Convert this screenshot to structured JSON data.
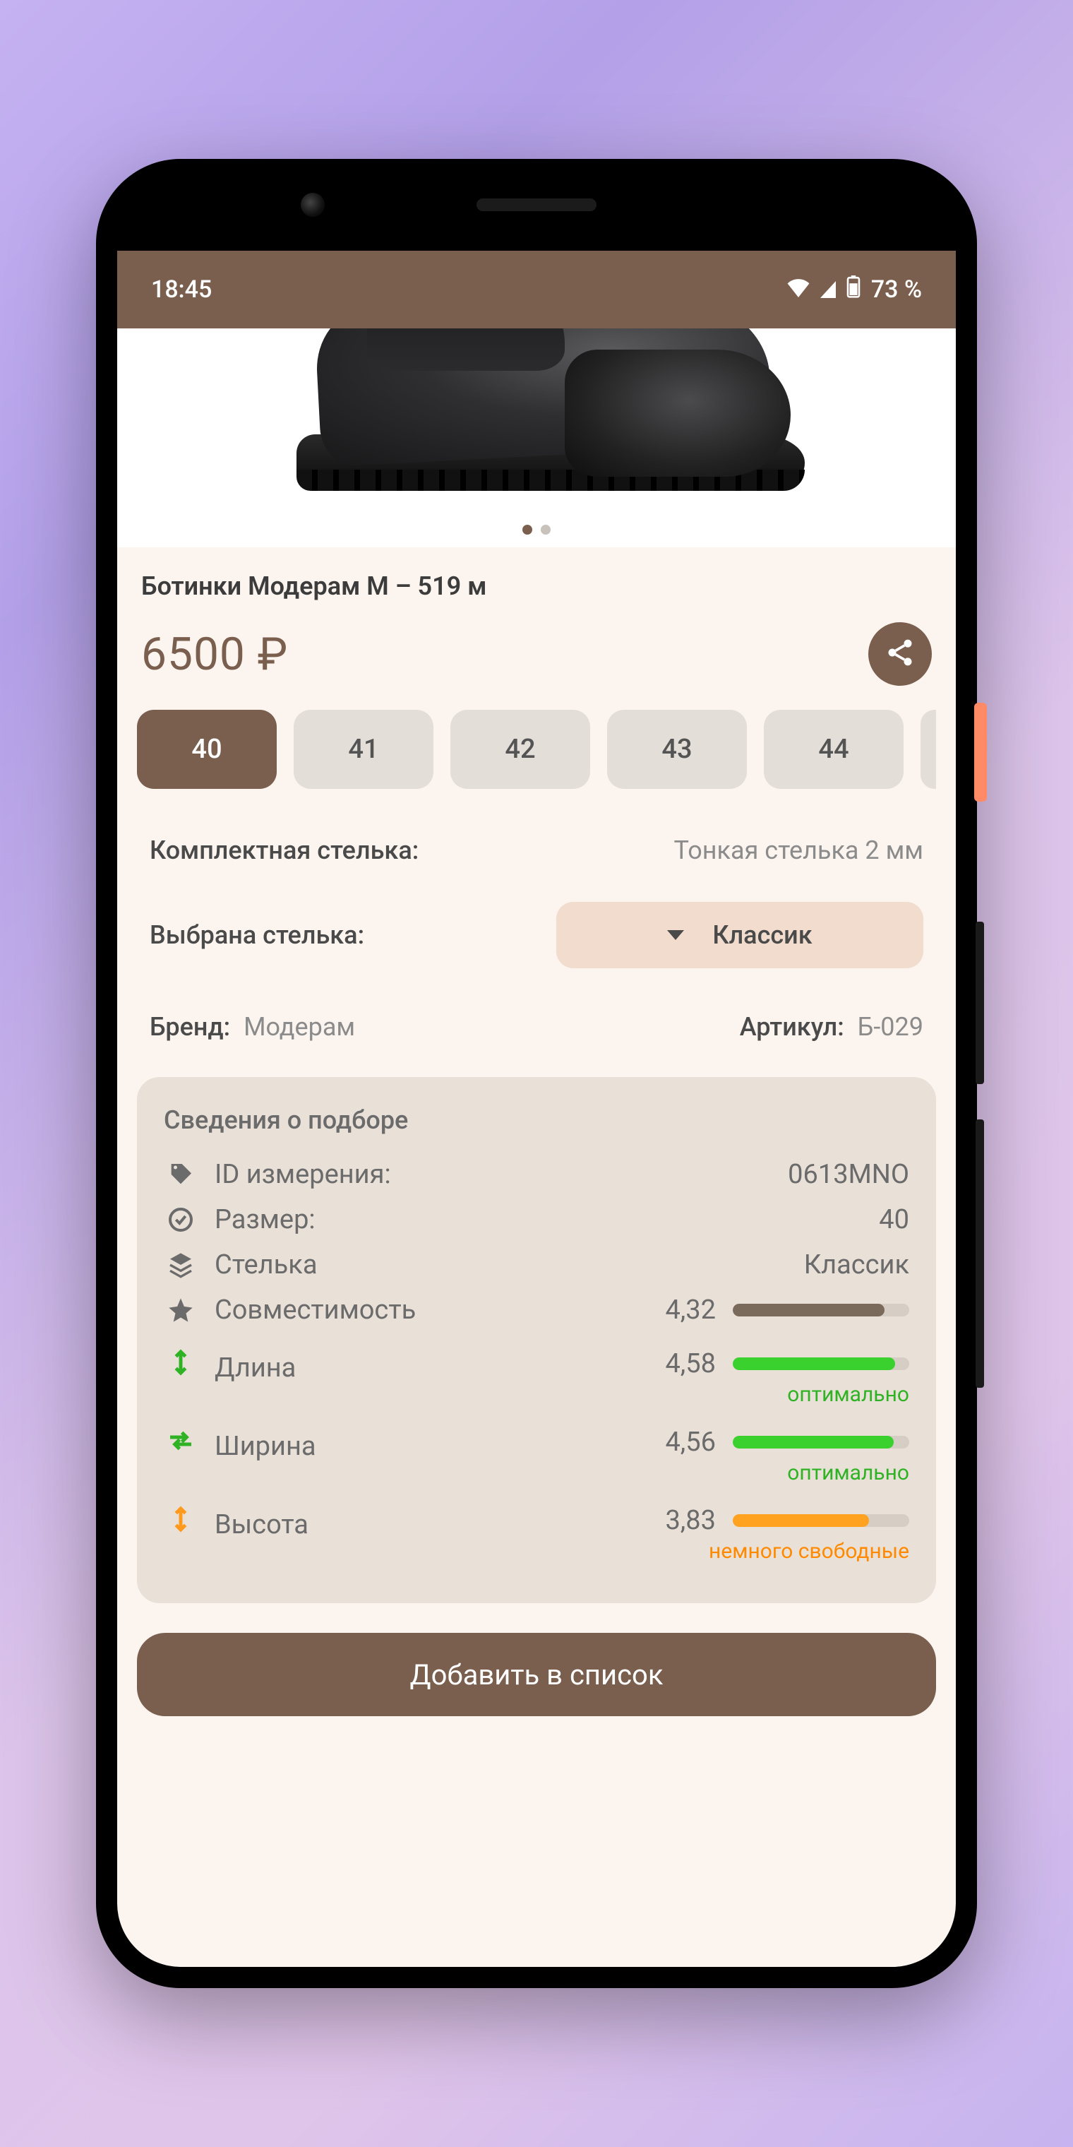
{
  "statusbar": {
    "time": "18:45",
    "battery": "73 %"
  },
  "product": {
    "title": "Ботинки Модерам М – 519 м",
    "price": "6500 ₽"
  },
  "sizes": [
    "40",
    "41",
    "42",
    "43",
    "44"
  ],
  "selected_size_index": 0,
  "insole": {
    "included_label": "Комплектная стелька:",
    "included_value": "Тонкая стелька 2 мм",
    "selected_label": "Выбрана стелька:",
    "selected_value": "Классик"
  },
  "meta": {
    "brand_label": "Бренд:",
    "brand_value": "Модерам",
    "article_label": "Артикул:",
    "article_value": "Б-029"
  },
  "fit": {
    "title": "Сведения о подборе",
    "id_label": "ID измерения:",
    "id_value": "0613MNO",
    "size_label": "Размер:",
    "size_value": "40",
    "insole_label": "Стелька",
    "insole_value": "Классик",
    "compat_label": "Совместимость",
    "compat_value": "4,32",
    "compat_pct": 86,
    "length_label": "Длина",
    "length_value": "4,58",
    "length_pct": 92,
    "length_note": "оптимально",
    "width_label": "Ширина",
    "width_value": "4,56",
    "width_pct": 91,
    "width_note": "оптимально",
    "height_label": "Высота",
    "height_value": "3,83",
    "height_pct": 77,
    "height_note": "немного свободные"
  },
  "cta": {
    "add": "Добавить в список"
  }
}
